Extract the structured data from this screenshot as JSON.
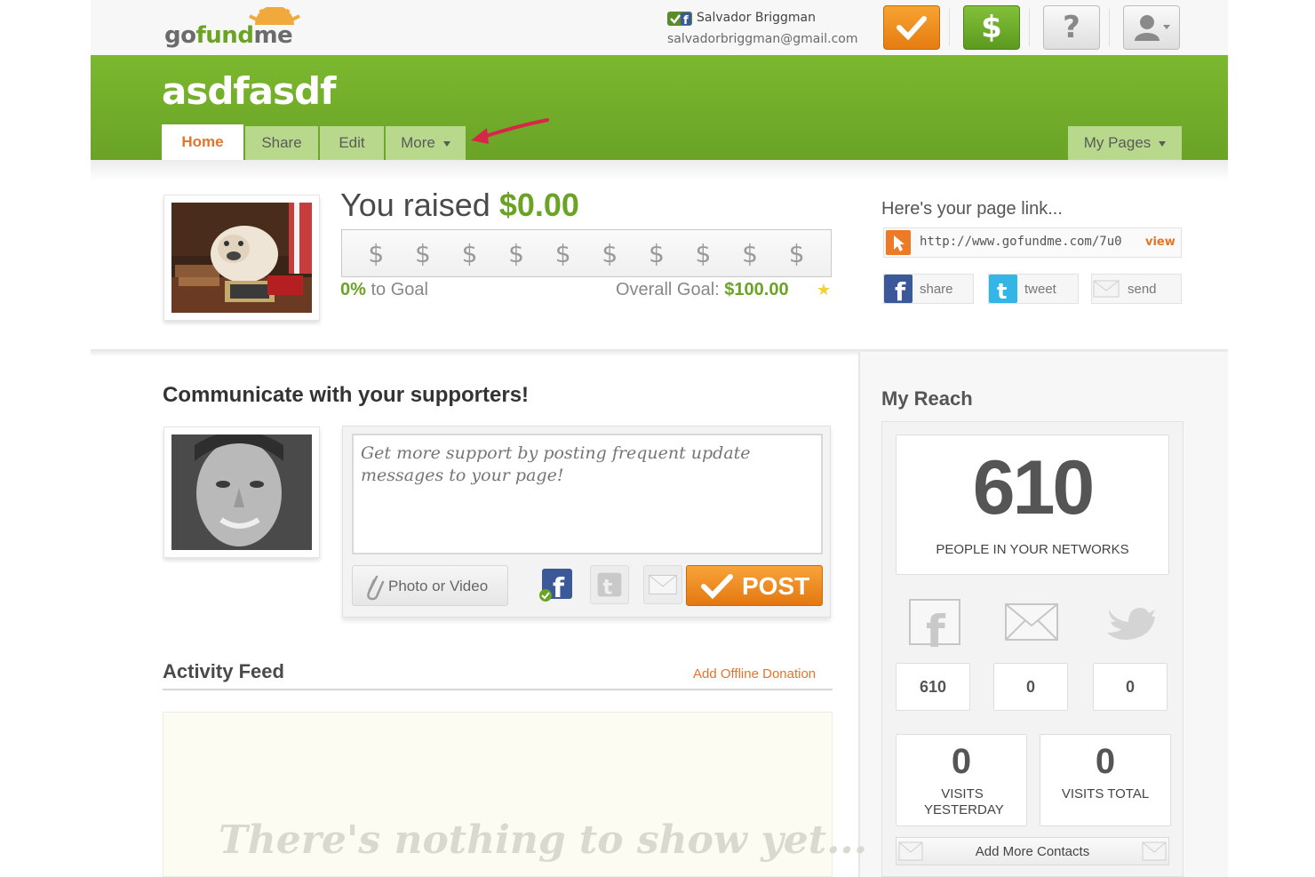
{
  "brand": {
    "logo_part1": "go",
    "logo_part2": "fund",
    "logo_part3": "me"
  },
  "user": {
    "name": "Salvador Briggman",
    "email": "salvadorbriggman@gmail.com"
  },
  "toolbar": {
    "help_label": "?",
    "dollar_label": "$"
  },
  "page": {
    "title": "asdfasdf"
  },
  "tabs": {
    "home": "Home",
    "share": "Share",
    "edit": "Edit",
    "more": "More",
    "my_pages": "My Pages"
  },
  "raised": {
    "prefix": "You raised",
    "amount": "$0.00",
    "dollar_symbols": [
      "$",
      "$",
      "$",
      "$",
      "$",
      "$",
      "$",
      "$",
      "$",
      "$"
    ],
    "progress_fraction": 0,
    "pct": "0%",
    "pct_suffix": "to Goal",
    "goal_label": "Overall Goal:",
    "goal_value": "$100.00"
  },
  "link": {
    "title": "Here's your page link...",
    "url": "http://www.gofundme.com/7u0",
    "view": "view"
  },
  "share": {
    "facebook": "share",
    "twitter": "tweet",
    "email": "send"
  },
  "communicate": {
    "title": "Communicate with your supporters!",
    "placeholder": "Get more support by posting frequent update messages to your page!",
    "photo_video": "Photo or Video",
    "post": "POST"
  },
  "feed": {
    "title": "Activity Feed",
    "offline_donation": "Add Offline Donation",
    "empty": "There's nothing to show yet..."
  },
  "reach": {
    "title": "My Reach",
    "people_count": "610",
    "people_label": "PEOPLE IN YOUR NETWORKS",
    "facebook_count": "610",
    "email_count": "0",
    "twitter_count": "0",
    "visits_yesterday": "0",
    "visits_yesterday_label": "VISITS YESTERDAY",
    "visits_total": "0",
    "visits_total_label": "VISITS TOTAL",
    "add_contacts": "Add More Contacts"
  },
  "colors": {
    "brand_green": "#6ba325",
    "accent_orange": "#e5742a",
    "header_green": "#7bb82f"
  }
}
